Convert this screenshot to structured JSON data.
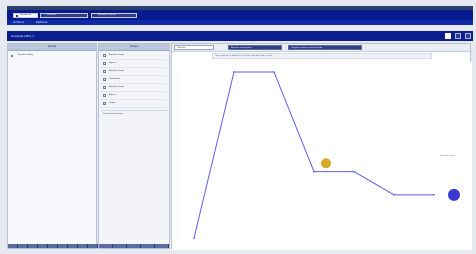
{
  "window": {
    "title": "",
    "subwindow_title": "Analysis (MC) 1"
  },
  "tabs": [
    {
      "label": "Workbench",
      "active": true
    },
    {
      "label": "Statistics",
      "active": false
    },
    {
      "label": "Reference Library",
      "active": false
    }
  ],
  "menu": {
    "items": [
      "Actions",
      "Options"
    ]
  },
  "left_panel": {
    "header": "Items",
    "items": [
      "Baseline Study"
    ]
  },
  "mid_panel": {
    "header": "Steps",
    "items": [
      "Baseline study",
      "Import",
      "Baseline study",
      "Calibration",
      "Baseline study",
      "Adjust",
      "Output"
    ],
    "footer": "Show selected steps"
  },
  "main": {
    "toolbar": {
      "select_value": "Timeline",
      "button_1": "Baseline comparison",
      "button_2": "Compare across selected steps"
    },
    "hint": "Drag markers to adjust the timeline; double-click to reset",
    "legend": "Baseline study"
  },
  "chart_data": {
    "type": "line",
    "title": "",
    "xlabel": "",
    "ylabel": "",
    "x": [
      1,
      2,
      3,
      4,
      5,
      6,
      7
    ],
    "y": [
      0,
      10,
      10,
      4,
      4,
      2.6,
      2.6
    ],
    "x_tick_labels": [
      "",
      "",
      "",
      "",
      "",
      "",
      ""
    ],
    "y_tick_labels": [
      "",
      "",
      "",
      "",
      "",
      "",
      "",
      "",
      "",
      "",
      ""
    ],
    "ylim": [
      0,
      10
    ],
    "grid": false,
    "markers": [
      {
        "name": "",
        "x": 4.3,
        "y": 4.5,
        "color": "#d6a31d"
      },
      {
        "name": "",
        "x": 7.5,
        "y": 2.6,
        "color": "#2f2fd0"
      }
    ],
    "line_color": "#5b61e8"
  }
}
